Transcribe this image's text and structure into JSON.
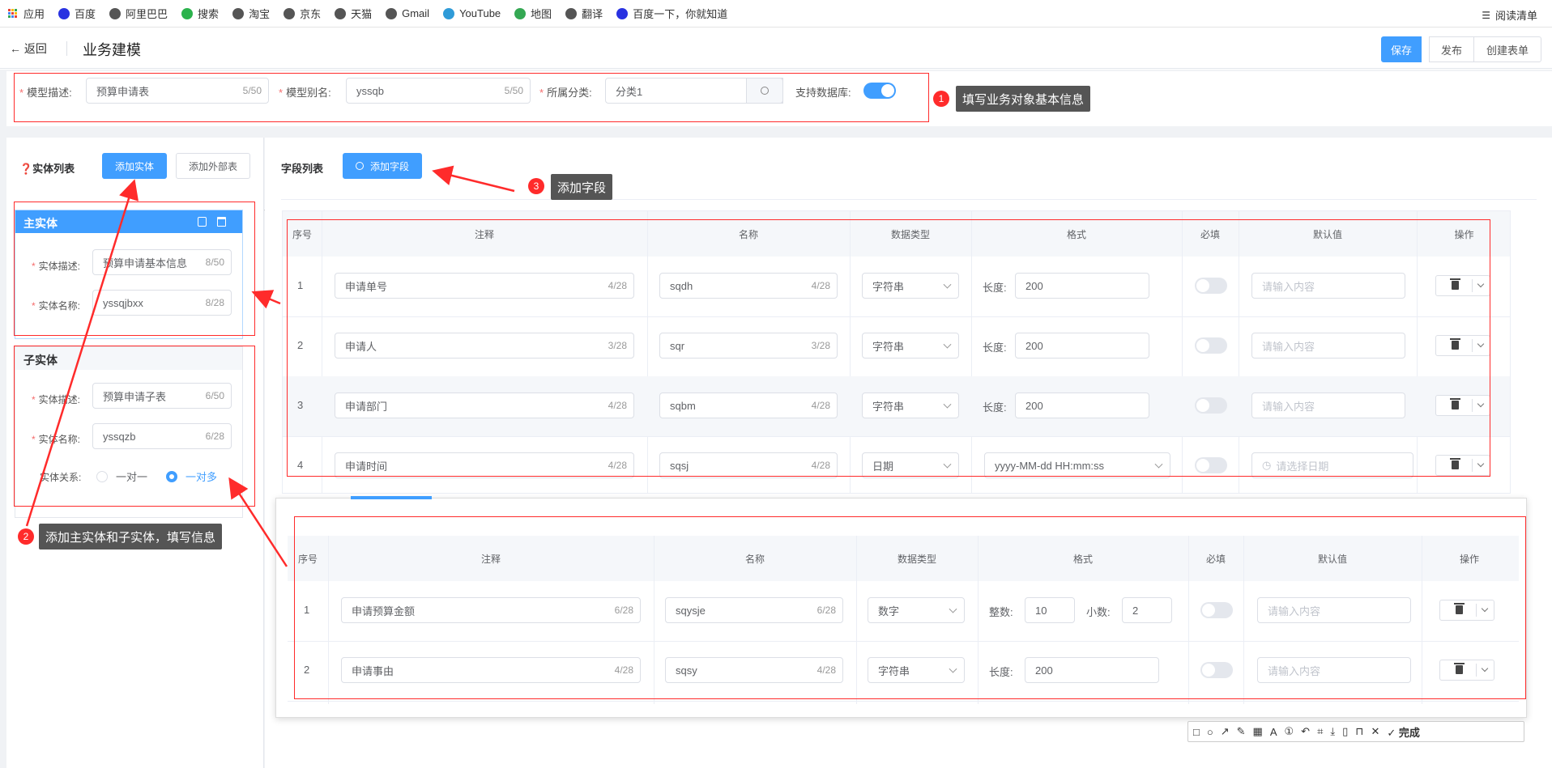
{
  "bookmarks": {
    "apps": "应用",
    "items": [
      {
        "label": "百度",
        "icon": "baidu-paw-icon",
        "color": "#2932e1"
      },
      {
        "label": "阿里巴巴",
        "icon": "globe-icon",
        "color": "#555555"
      },
      {
        "label": "搜索",
        "icon": "search-ring-icon",
        "color": "#2bb24c"
      },
      {
        "label": "淘宝",
        "icon": "globe-icon",
        "color": "#555555"
      },
      {
        "label": "京东",
        "icon": "globe-icon",
        "color": "#555555"
      },
      {
        "label": "天猫",
        "icon": "globe-icon",
        "color": "#555555"
      },
      {
        "label": "Gmail",
        "icon": "globe-icon",
        "color": "#555555"
      },
      {
        "label": "YouTube",
        "icon": "tv-icon",
        "color": "#2f9bd8"
      },
      {
        "label": "地图",
        "icon": "map-icon",
        "color": "#34a853"
      },
      {
        "label": "翻译",
        "icon": "globe-icon",
        "color": "#555555"
      },
      {
        "label": "百度一下，你就知道",
        "icon": "baidu-paw-icon",
        "color": "#2932e1"
      }
    ],
    "reading_list": "阅读清单"
  },
  "toolbar": {
    "back": "← 返回",
    "title": "业务建模",
    "save": "保存",
    "publish": "发布",
    "create_form": "创建表单"
  },
  "basic_info": {
    "desc_label": "模型描述:",
    "desc_value": "预算申请表",
    "desc_count": "5/50",
    "alias_label": "模型别名:",
    "alias_value": "yssqb",
    "alias_count": "5/50",
    "category_label": "所属分类:",
    "category_value": "分类1",
    "db_label": "支持数据库:",
    "db_enabled": true
  },
  "annotations": {
    "a1_num": "1",
    "a1_text": "填写业务对象基本信息",
    "a2_num": "2",
    "a2_text": "添加主实体和子实体，填写信息",
    "a3_num": "3",
    "a3_text": "添加字段"
  },
  "entity_list": {
    "title": "❓实体列表",
    "add_entity": "添加实体",
    "add_external": "添加外部表",
    "main": {
      "title": "主实体",
      "desc_label": "实体描述:",
      "desc_value": "预算申请基本信息",
      "desc_count": "8/50",
      "name_label": "实体名称:",
      "name_value": "yssqjbxx",
      "name_count": "8/28"
    },
    "sub": {
      "title": "子实体",
      "desc_label": "实体描述:",
      "desc_value": "预算申请子表",
      "desc_count": "6/50",
      "name_label": "实体名称:",
      "name_value": "yssqzb",
      "name_count": "6/28",
      "relation_label": "实体关系:",
      "opt1": "一对一",
      "opt2": "一对多"
    }
  },
  "fields": {
    "title": "字段列表",
    "add_field": "添加字段",
    "headers": [
      "序号",
      "注释",
      "名称",
      "数据类型",
      "格式",
      "必填",
      "默认值",
      "操作"
    ],
    "length_label": "长度:",
    "placeholder_default": "请输入内容",
    "placeholder_date": "请选择日期",
    "rows": [
      {
        "no": "1",
        "comment": "申请单号",
        "comment_count": "4/28",
        "name": "sqdh",
        "name_count": "4/28",
        "type": "字符串",
        "format": "200"
      },
      {
        "no": "2",
        "comment": "申请人",
        "comment_count": "3/28",
        "name": "sqr",
        "name_count": "3/28",
        "type": "字符串",
        "format": "200"
      },
      {
        "no": "3",
        "comment": "申请部门",
        "comment_count": "4/28",
        "name": "sqbm",
        "name_count": "4/28",
        "type": "字符串",
        "format": "200"
      },
      {
        "no": "4",
        "comment": "申请时间",
        "comment_count": "4/28",
        "name": "sqsj",
        "name_count": "4/28",
        "type": "日期",
        "format": "yyyy-MM-dd HH:mm:ss"
      }
    ]
  },
  "sub_fields": {
    "headers": [
      "序号",
      "注释",
      "名称",
      "数据类型",
      "格式",
      "必填",
      "默认值",
      "操作"
    ],
    "int_label": "整数:",
    "dec_label": "小数:",
    "length_label": "长度:",
    "placeholder_default": "请输入内容",
    "rows": [
      {
        "no": "1",
        "comment": "申请预算金额",
        "comment_count": "6/28",
        "name": "sqysje",
        "name_count": "6/28",
        "type": "数字",
        "int": "10",
        "dec": "2"
      },
      {
        "no": "2",
        "comment": "申请事由",
        "comment_count": "4/28",
        "name": "sqsy",
        "name_count": "4/28",
        "type": "字符串",
        "format": "200"
      }
    ]
  },
  "screenshot_toolbar": {
    "done": "完成"
  }
}
